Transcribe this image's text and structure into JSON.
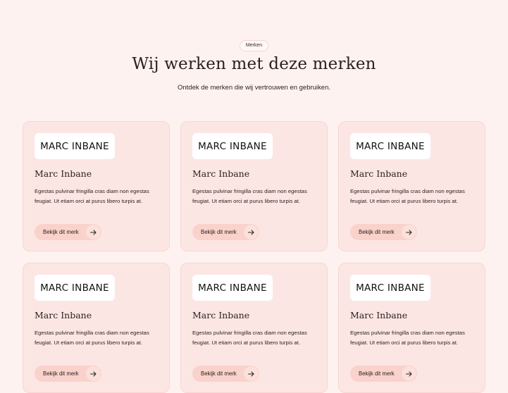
{
  "header": {
    "badge": "Merken",
    "title": "Wij werken met deze merken",
    "subtitle": "Ontdek de merken die wij vertrouwen en gebruiken."
  },
  "icons": {
    "arrow": "arrow-right-icon"
  },
  "colors": {
    "background": "#fdf2f0",
    "card": "#fce6e3",
    "button": "#f9d2cb",
    "text": "#2a1f1d"
  },
  "brands": [
    {
      "logo": "MARC INBANE",
      "name": "Marc Inbane",
      "description": "Egestas pulvinar fringilla cras diam non egestas feugiat. Ut etiam orci at purus libero turpis at.",
      "button": "Bekijk dit merk"
    },
    {
      "logo": "MARC INBANE",
      "name": "Marc Inbane",
      "description": "Egestas pulvinar fringilla cras diam non egestas feugiat. Ut etiam orci at purus libero turpis at.",
      "button": "Bekijk dit merk"
    },
    {
      "logo": "MARC INBANE",
      "name": "Marc Inbane",
      "description": "Egestas pulvinar fringilla cras diam non egestas feugiat. Ut etiam orci at purus libero turpis at.",
      "button": "Bekijk dit merk"
    },
    {
      "logo": "MARC INBANE",
      "name": "Marc Inbane",
      "description": "Egestas pulvinar fringilla cras diam non egestas feugiat. Ut etiam orci at purus libero turpis at.",
      "button": "Bekijk dit merk"
    },
    {
      "logo": "MARC INBANE",
      "name": "Marc Inbane",
      "description": "Egestas pulvinar fringilla cras diam non egestas feugiat. Ut etiam orci at purus libero turpis at.",
      "button": "Bekijk dit merk"
    },
    {
      "logo": "MARC INBANE",
      "name": "Marc Inbane",
      "description": "Egestas pulvinar fringilla cras diam non egestas feugiat. Ut etiam orci at purus libero turpis at.",
      "button": "Bekijk dit merk"
    }
  ]
}
